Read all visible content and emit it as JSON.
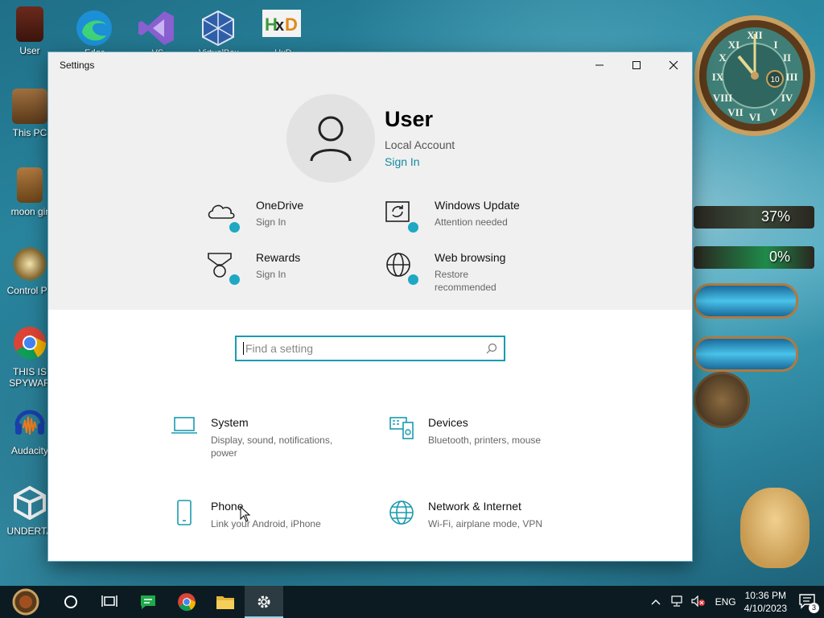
{
  "desktop": {
    "left_icons": [
      {
        "label": "User",
        "icon": "user-folder-icon"
      },
      {
        "label": "This PC",
        "icon": "this-pc-icon"
      },
      {
        "label": "moon gir",
        "icon": "moon-girl-icon"
      },
      {
        "label": "Control Pa",
        "icon": "control-panel-icon"
      },
      {
        "label": "THIS IS",
        "label2": "SPYWAR",
        "icon": "chrome-icon"
      },
      {
        "label": "Audacity",
        "icon": "audacity-icon"
      },
      {
        "label": "UNDERTA",
        "icon": "unity-icon"
      }
    ],
    "top_icons": [
      {
        "label": "Edge",
        "icon": "edge-icon"
      },
      {
        "label": "VS",
        "icon": "visual-studio-icon"
      },
      {
        "label": "VirtualBox",
        "icon": "virtualbox-icon"
      },
      {
        "label": "HxD",
        "icon": "hxd-icon"
      }
    ],
    "gauges": [
      {
        "value": "37%"
      },
      {
        "value": "0%"
      }
    ]
  },
  "window": {
    "title": "Settings",
    "user": {
      "name": "User",
      "account_type": "Local Account",
      "sign_in": "Sign In"
    },
    "tiles": [
      {
        "title": "OneDrive",
        "sub": "Sign In",
        "icon": "onedrive-cloud-icon"
      },
      {
        "title": "Windows Update",
        "sub": "Attention needed",
        "icon": "windows-update-icon"
      },
      {
        "title": "Rewards",
        "sub": "Sign In",
        "icon": "rewards-medal-icon"
      },
      {
        "title": "Web browsing",
        "sub": "Restore recommended",
        "icon": "globe-icon"
      }
    ],
    "search": {
      "placeholder": "Find a setting"
    },
    "categories": [
      {
        "title": "System",
        "sub": "Display, sound, notifications, power",
        "icon": "laptop-icon"
      },
      {
        "title": "Devices",
        "sub": "Bluetooth, printers, mouse",
        "icon": "devices-icon"
      },
      {
        "title": "Phone",
        "sub": "Link your Android, iPhone",
        "icon": "phone-icon"
      },
      {
        "title": "Network & Internet",
        "sub": "Wi-Fi, airplane mode, VPN",
        "icon": "globe-icon"
      }
    ]
  },
  "taskbar": {
    "language": "ENG",
    "time": "10:36 PM",
    "date": "4/10/2023",
    "notifications": "3"
  },
  "colors": {
    "accent": "#1a9bb1",
    "badge": "#1ea8c3",
    "taskbar": "#0c1b22"
  }
}
